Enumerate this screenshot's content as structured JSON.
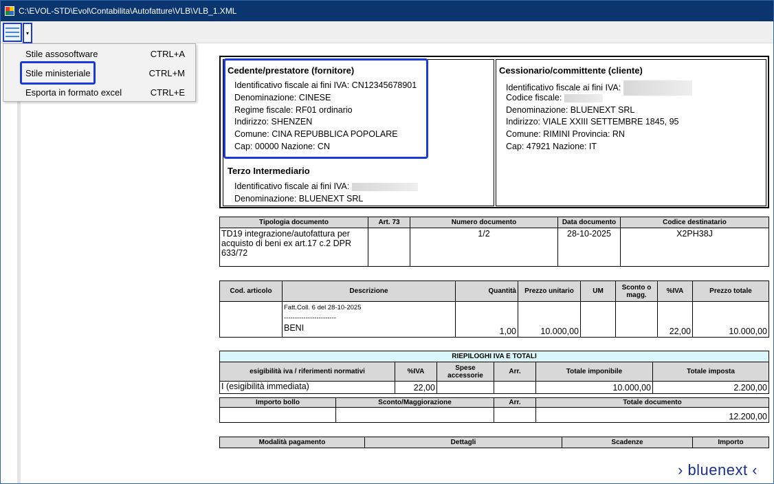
{
  "window": {
    "title": "C:\\EVOL-STD\\Evol\\Contabilita\\Autofatture\\VLB\\VLB_1.XML"
  },
  "toolbar": {
    "menu_icon": "hamburger-icon",
    "dropdown_icon": "chevron-down-icon",
    "dropdown_glyph": "▾"
  },
  "menu": {
    "items": [
      {
        "label": "Stile assosoftware",
        "shortcut": "CTRL+A"
      },
      {
        "label": "Stile ministeriale",
        "shortcut": "CTRL+M"
      },
      {
        "label": "Esporta in formato excel",
        "shortcut": "CTRL+E"
      }
    ]
  },
  "cedente": {
    "header": "Cedente/prestatore (fornitore)",
    "lines": [
      "Identificativo fiscale ai fini IVA: CN12345678901",
      "Denominazione: CINESE",
      "Regime fiscale: RF01 ordinario",
      "Indirizzo: SHENZEN",
      "Comune: CINA REPUBBLICA POPOLARE",
      "Cap: 00000 Nazione: CN"
    ]
  },
  "terzo": {
    "header": "Terzo Intermediario",
    "lines": [
      "Identificativo fiscale ai fini IVA:",
      "Denominazione: BLUENEXT SRL"
    ]
  },
  "cessionario": {
    "header": "Cessionario/committente (cliente)",
    "lines": [
      "Identificativo fiscale ai fini IVA:",
      "Codice fiscale: ",
      "Denominazione: BLUENEXT SRL",
      "Indirizzo: VIALE XXIII SETTEMBRE 1845, 95",
      "Comune: RIMINI Provincia: RN",
      "Cap: 47921 Nazione: IT"
    ]
  },
  "doc_table": {
    "headers": [
      "Tipologia documento",
      "Art. 73",
      "Numero documento",
      "Data documento",
      "Codice destinatario"
    ],
    "row": [
      "TD19 integrazione/autofattura per acquisto di beni ex art.17 c.2 DPR 633/72",
      "",
      "1/2",
      "28-10-2025",
      "X2PH38J"
    ]
  },
  "items_table": {
    "headers": [
      "Cod. articolo",
      "Descrizione",
      "Quantità",
      "Prezzo unitario",
      "UM",
      "Sconto o magg.",
      "%IVA",
      "Prezzo totale"
    ],
    "desc_note": "Fatt.Coll. 6 del 28-10-2025",
    "desc_sep": "------------------------",
    "row": {
      "code": "",
      "desc": "BENI",
      "qty": "1,00",
      "unit_price": "10.000,00",
      "um": "",
      "discount": "",
      "iva": "22,00",
      "total": "10.000,00"
    }
  },
  "summary": {
    "title": "RIEPILOGHI IVA E TOTALI",
    "headers": [
      "esigibilità iva / riferimenti normativi",
      "%IVA",
      "Spese accessorie",
      "Arr.",
      "Totale imponibile",
      "Totale imposta"
    ],
    "row": [
      "I (esigibilità immediata)",
      "22,00",
      "",
      "",
      "10.000,00",
      "2.200,00"
    ],
    "headers2": [
      "Importo bollo",
      "Sconto/Maggiorazione",
      "Arr.",
      "Totale documento"
    ],
    "row2": [
      "",
      "",
      "",
      "12.200,00"
    ]
  },
  "payment": {
    "headers": [
      "Modalità pagamento",
      "Dettagli",
      "Scadenze",
      "Importo"
    ]
  },
  "brand": {
    "text": "› bluenext ‹"
  },
  "colors": {
    "titlebar": "#0b356f",
    "highlight": "#1a3ad6",
    "header_gray": "#d8d8d8",
    "summary_cyan": "#d9f7fb",
    "brand": "#1a2f8f"
  }
}
